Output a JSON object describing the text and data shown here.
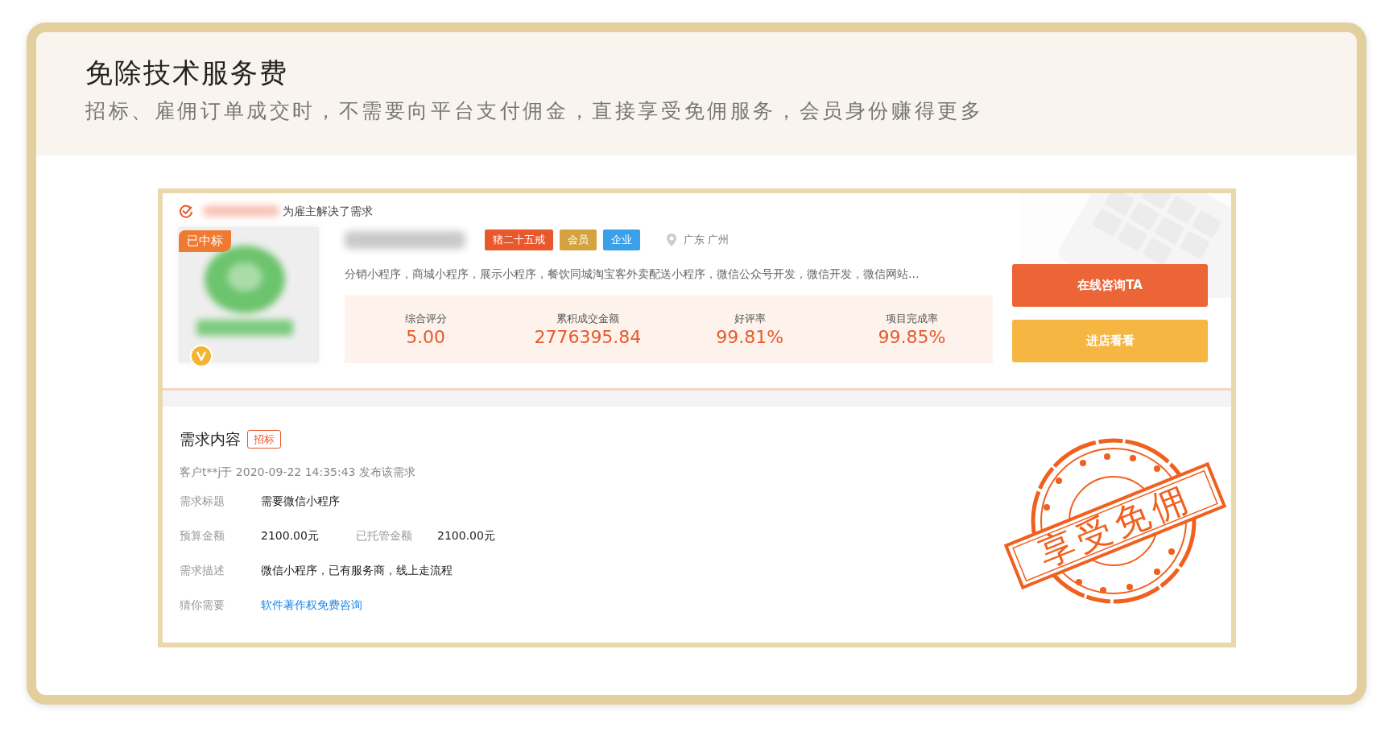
{
  "promo": {
    "title": "免除技术服务费",
    "subtitle": "招标、雇佣订单成交时，不需要向平台支付佣金，直接享受免佣服务，会员身份赚得更多"
  },
  "screenshot": {
    "solved_text": "为雇主解决了需求",
    "won_badge": "已中标",
    "tags": [
      {
        "label": "猪二十五戒",
        "color": "#e8582c"
      },
      {
        "label": "会员",
        "color": "#d4a23f"
      },
      {
        "label": "企业",
        "color": "#3aa0e8"
      }
    ],
    "location": "广东 广州",
    "services": "分销小程序，商城小程序，展示小程序，餐饮同城淘宝客外卖配送小程序，微信公众号开发，微信开发，微信网站...",
    "stats": [
      {
        "label": "综合评分",
        "value": "5.00"
      },
      {
        "label": "累积成交金额",
        "value": "2776395.84"
      },
      {
        "label": "好评率",
        "value": "99.81%"
      },
      {
        "label": "项目完成率",
        "value": "99.85%"
      }
    ],
    "buttons": [
      {
        "label": "在线咨询TA",
        "kind": "primary"
      },
      {
        "label": "进店看看",
        "kind": "secondary"
      }
    ],
    "requirement": {
      "title": "需求内容",
      "tag": "招标",
      "meta": "客户t**j于 2020-09-22 14:35:43 发布该需求",
      "rows": [
        {
          "items": [
            {
              "label": "需求标题",
              "value": "需要微信小程序",
              "kind": "text"
            }
          ]
        },
        {
          "items": [
            {
              "label": "预算金额",
              "value": "2100.00元",
              "kind": "text"
            },
            {
              "label": "已托管金额",
              "value": "2100.00元",
              "kind": "text"
            }
          ]
        },
        {
          "items": [
            {
              "label": "需求描述",
              "value": "微信小程序，已有服务商，线上走流程",
              "kind": "text"
            }
          ]
        },
        {
          "items": [
            {
              "label": "猜你需要",
              "value": "软件著作权免费咨询",
              "kind": "link"
            }
          ]
        }
      ]
    },
    "stamp": "享受免佣"
  }
}
